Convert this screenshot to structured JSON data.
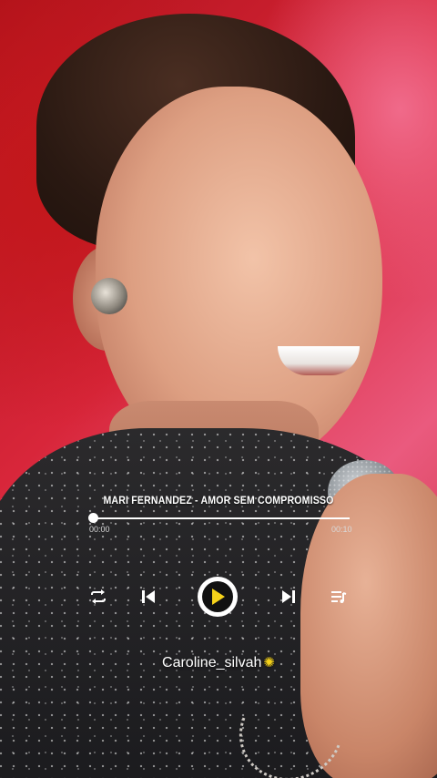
{
  "player": {
    "song_title": "MARI FERNANDEZ - AMOR SEM COMPROMISSO",
    "time_current": "00:00",
    "time_total": "00:10",
    "progress": 0.0,
    "controls": {
      "repeat_icon": "repeat-icon",
      "prev_icon": "skip-previous-icon",
      "play_icon": "play-icon",
      "next_icon": "skip-next-icon",
      "queue_icon": "playlist-queue-icon"
    },
    "accent_color": "#f5d21a"
  },
  "overlay": {
    "username": "Caroline_silvah",
    "emoji_icon": "sun-icon"
  }
}
